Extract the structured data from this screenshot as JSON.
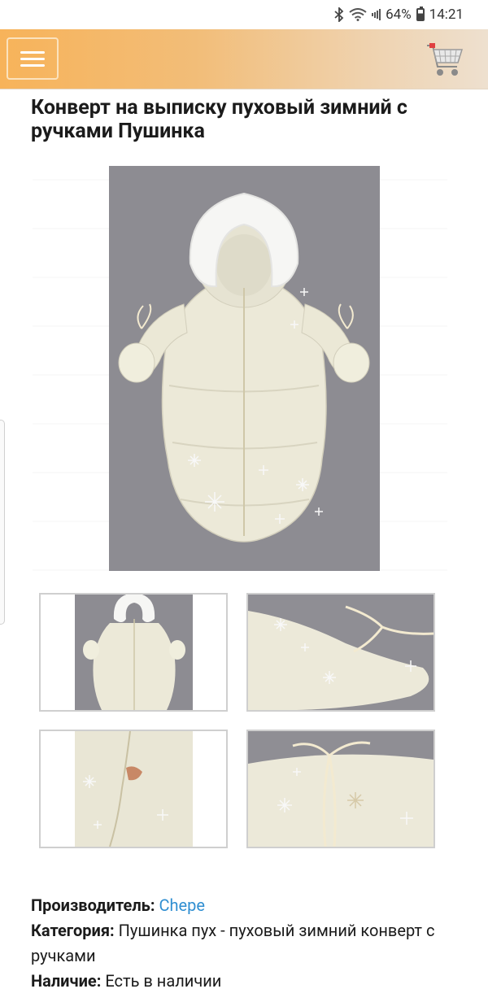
{
  "status_bar": {
    "battery": "64%",
    "time": "14:21",
    "icons": [
      "bluetooth-icon",
      "wifi-icon",
      "signal-icon",
      "battery-icon"
    ]
  },
  "header": {
    "menu_icon": "hamburger-menu-icon",
    "cart_icon": "shopping-cart-icon"
  },
  "product": {
    "title": "Конверт на выписку пуховый зимний с ручками Пушинка",
    "main_image": "product-photo-envelope",
    "thumbnails": [
      "thumb-front",
      "thumb-hand-detail",
      "thumb-zipper-detail",
      "thumb-bottom-detail"
    ]
  },
  "info": {
    "manufacturer_label": "Производитель:",
    "manufacturer_value": "Chepe",
    "category_label": "Категория:",
    "category_value": "Пушинка пух - пуховый зимний конверт с ручками",
    "availability_label": "Наличие:",
    "availability_value": "Есть в наличии"
  },
  "colors": {
    "header_gradient_start": "#f7b35a",
    "header_gradient_end": "#eee0cf",
    "link": "#2f8ed1"
  }
}
